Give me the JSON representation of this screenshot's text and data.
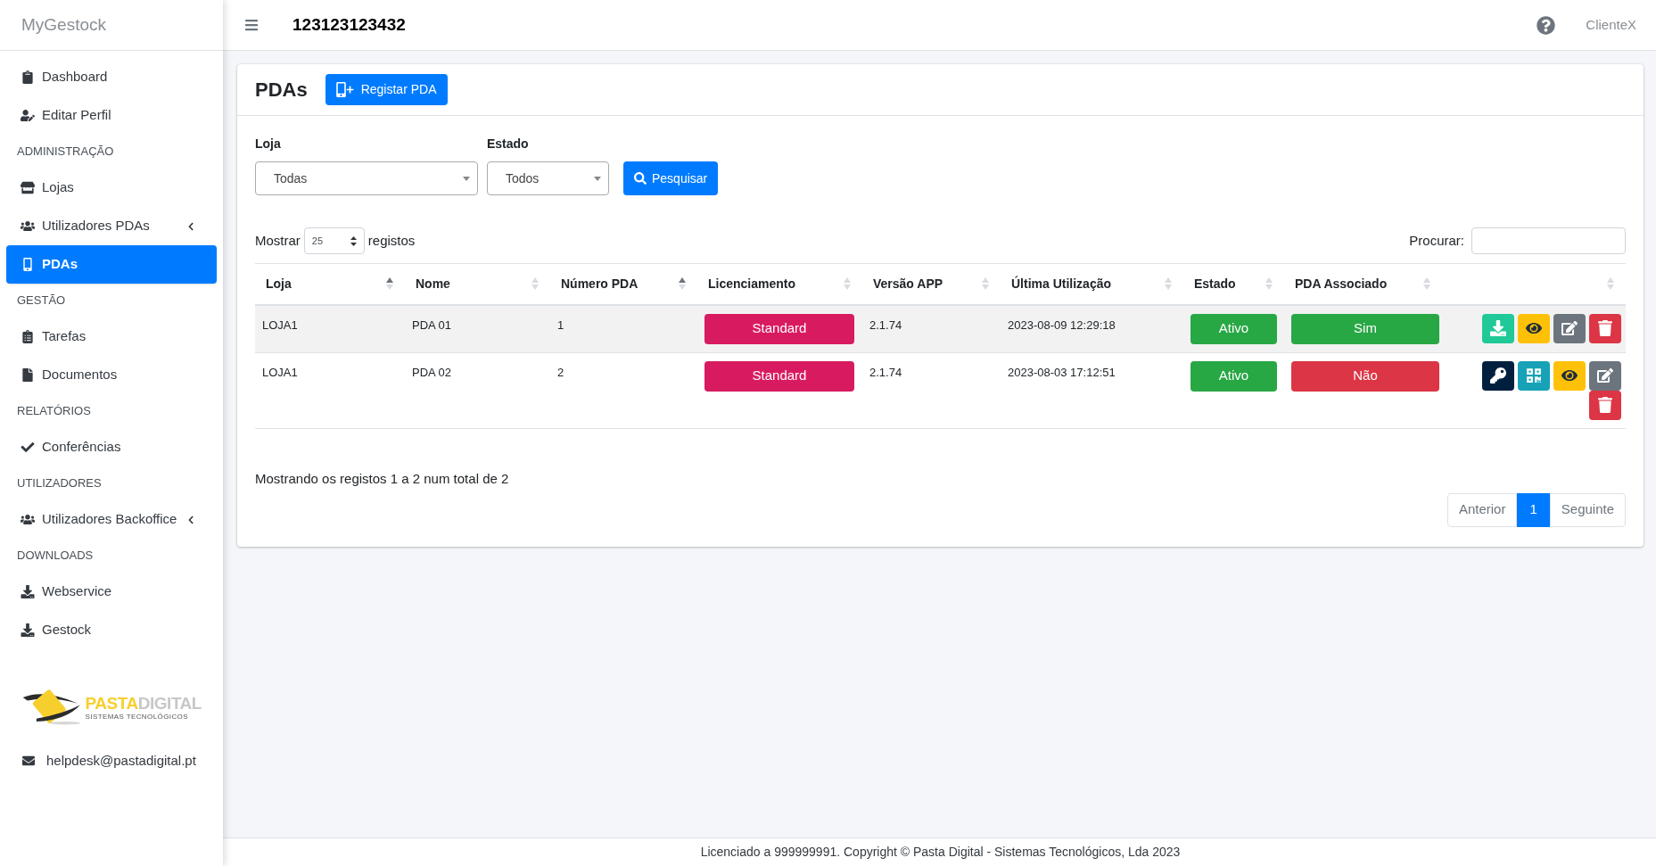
{
  "sidebar": {
    "brand": "MyGestock",
    "items": [
      {
        "kind": "link",
        "label": "Dashboard",
        "selected": false,
        "expandable": false
      },
      {
        "kind": "link",
        "label": "Editar Perfil",
        "selected": false,
        "expandable": false
      },
      {
        "kind": "header",
        "label": "ADMINISTRAÇÃO"
      },
      {
        "kind": "link",
        "label": "Lojas",
        "selected": false,
        "expandable": false
      },
      {
        "kind": "link",
        "label": "Utilizadores PDAs",
        "selected": false,
        "expandable": true
      },
      {
        "kind": "link",
        "label": "PDAs",
        "selected": true,
        "expandable": false
      },
      {
        "kind": "header",
        "label": "GESTÃO"
      },
      {
        "kind": "link",
        "label": "Tarefas",
        "selected": false,
        "expandable": false
      },
      {
        "kind": "link",
        "label": "Documentos",
        "selected": false,
        "expandable": false
      },
      {
        "kind": "header",
        "label": "RELATÓRIOS"
      },
      {
        "kind": "link",
        "label": "Conferências",
        "selected": false,
        "expandable": false
      },
      {
        "kind": "header",
        "label": "UTILIZADORES"
      },
      {
        "kind": "link",
        "label": "Utilizadores Backoffice",
        "selected": false,
        "expandable": true
      },
      {
        "kind": "header",
        "label": "DOWNLOADS"
      },
      {
        "kind": "link",
        "label": "Webservice",
        "selected": false,
        "expandable": false
      },
      {
        "kind": "link",
        "label": "Gestock",
        "selected": false,
        "expandable": false
      }
    ],
    "logo": {
      "name_first": "PASTA",
      "name_second": "DIGITAL",
      "tagline": "SISTEMAS TECNOLÓGICOS"
    },
    "email": "helpdesk@pastadigital.pt"
  },
  "header": {
    "title": "123123123432",
    "user": "ClienteX"
  },
  "page": {
    "title": "PDAs",
    "register_button": "Registar PDA"
  },
  "filters": [
    {
      "label": "Loja",
      "value": "Todas"
    },
    {
      "label": "Estado",
      "value": "Todos"
    }
  ],
  "search_button": "Pesquisar",
  "length_menu": {
    "before": "Mostrar",
    "value": "25",
    "after": "registos"
  },
  "search": {
    "label": "Procurar:"
  },
  "table": {
    "columns": [
      {
        "label": "Loja",
        "sorted": true
      },
      {
        "label": "Nome",
        "sorted": false
      },
      {
        "label": "Número PDA",
        "sorted": true
      },
      {
        "label": "Licenciamento",
        "sorted": false
      },
      {
        "label": "Versão APP",
        "sorted": false
      },
      {
        "label": "Última Utilização",
        "sorted": false
      },
      {
        "label": "Estado",
        "sorted": false
      },
      {
        "label": "PDA Associado",
        "sorted": false
      },
      {
        "sorted": false
      }
    ],
    "rows": [
      {
        "loja": "LOJA1",
        "nome": "PDA 01",
        "numero": "1",
        "licenciamento": {
          "text": "Standard",
          "color": "#d81b60"
        },
        "versao": "2.1.74",
        "ultima": "2023-08-09 12:29:18",
        "estado": {
          "text": "Ativo",
          "color": "#28a745"
        },
        "associado": {
          "text": "Sim",
          "color": "#28a745"
        },
        "actions": [
          {
            "kind": "download"
          },
          {
            "kind": "view"
          },
          {
            "kind": "edit"
          },
          {
            "kind": "delete"
          }
        ]
      },
      {
        "loja": "LOJA1",
        "nome": "PDA 02",
        "numero": "2",
        "licenciamento": {
          "text": "Standard",
          "color": "#d81b60"
        },
        "versao": "2.1.74",
        "ultima": "2023-08-03 17:12:51",
        "estado": {
          "text": "Ativo",
          "color": "#28a745"
        },
        "associado": {
          "text": "Não",
          "color": "#dc3545"
        },
        "actions": [
          {
            "kind": "key"
          },
          {
            "kind": "qr"
          },
          {
            "kind": "view"
          },
          {
            "kind": "edit"
          },
          {
            "kind": "delete"
          }
        ]
      }
    ]
  },
  "info": "Mostrando os registos 1 a 2 num total de 2",
  "pagination": {
    "previous": "Anterior",
    "pages": [
      {
        "label": "1",
        "selected": true
      }
    ],
    "next": "Seguinte"
  },
  "footer": "Licenciado a 999999991. Copyright © Pasta Digital - Sistemas Tecnológicos, Lda 2023"
}
